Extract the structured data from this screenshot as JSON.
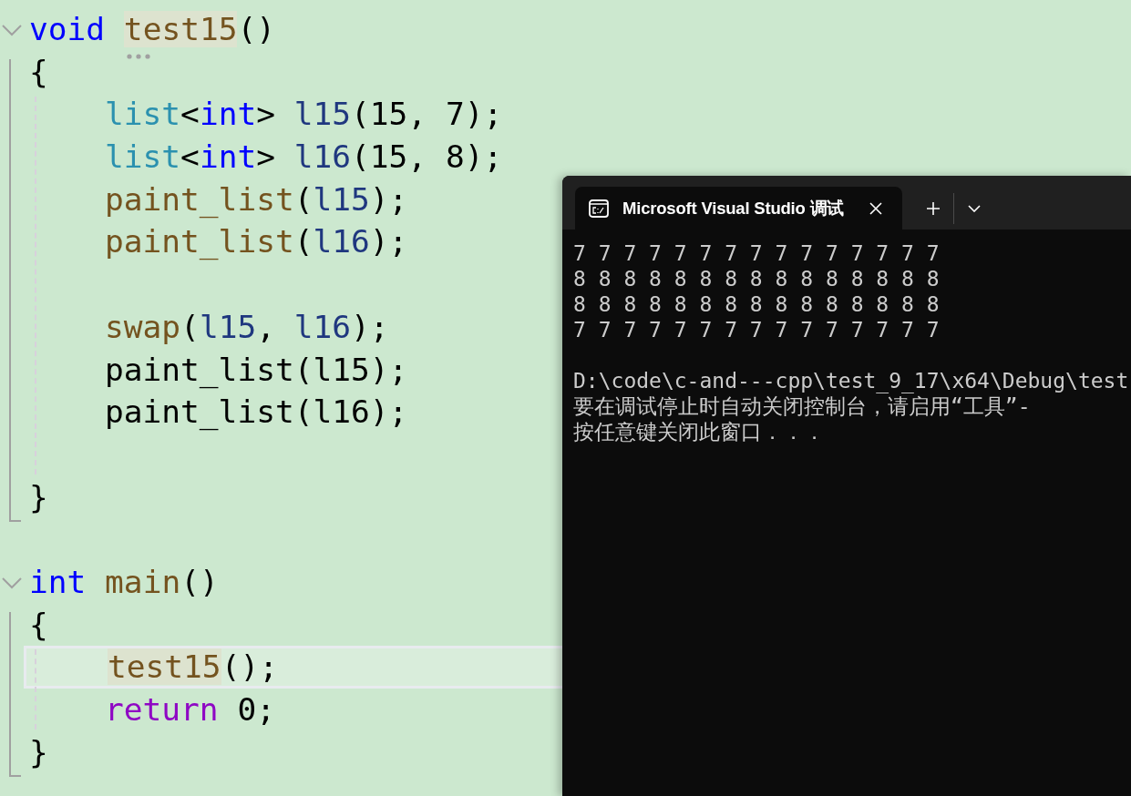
{
  "editor": {
    "blocks": [
      {
        "expanded": true,
        "head": [
          {
            "kind": "code",
            "current": false,
            "tokens": [
              {
                "text": "void ",
                "kind": "keyword"
              },
              {
                "text": "test15",
                "kind": "function",
                "highlight": true,
                "hint": true
              },
              {
                "text": "()",
                "kind": "plain"
              }
            ]
          },
          {
            "kind": "code",
            "current": false,
            "tokens": [
              {
                "text": "{",
                "kind": "plain"
              }
            ]
          }
        ],
        "body": [
          {
            "kind": "code",
            "current": false,
            "tokens": [
              {
                "text": "list",
                "kind": "type"
              },
              {
                "text": "<",
                "kind": "plain"
              },
              {
                "text": "int",
                "kind": "keyword"
              },
              {
                "text": "> ",
                "kind": "plain"
              },
              {
                "text": "l15",
                "kind": "variable"
              },
              {
                "text": "(15, 7);",
                "kind": "plain"
              }
            ]
          },
          {
            "kind": "code",
            "current": false,
            "tokens": [
              {
                "text": "list",
                "kind": "type"
              },
              {
                "text": "<",
                "kind": "plain"
              },
              {
                "text": "int",
                "kind": "keyword"
              },
              {
                "text": "> ",
                "kind": "plain"
              },
              {
                "text": "l16",
                "kind": "variable"
              },
              {
                "text": "(15, 8);",
                "kind": "plain"
              }
            ]
          },
          {
            "kind": "code",
            "current": false,
            "tokens": [
              {
                "text": "paint_list",
                "kind": "function"
              },
              {
                "text": "(",
                "kind": "plain"
              },
              {
                "text": "l15",
                "kind": "variable"
              },
              {
                "text": ");",
                "kind": "plain"
              }
            ]
          },
          {
            "kind": "code",
            "current": false,
            "tokens": [
              {
                "text": "paint_list",
                "kind": "function"
              },
              {
                "text": "(",
                "kind": "plain"
              },
              {
                "text": "l16",
                "kind": "variable"
              },
              {
                "text": ");",
                "kind": "plain"
              }
            ]
          },
          {
            "kind": "blank"
          },
          {
            "kind": "code",
            "current": false,
            "tokens": [
              {
                "text": "swap",
                "kind": "function"
              },
              {
                "text": "(",
                "kind": "plain"
              },
              {
                "text": "l15",
                "kind": "variable"
              },
              {
                "text": ", ",
                "kind": "plain"
              },
              {
                "text": "l16",
                "kind": "variable"
              },
              {
                "text": ");",
                "kind": "plain"
              }
            ]
          },
          {
            "kind": "code",
            "current": false,
            "tokens": [
              {
                "text": "paint_list(l15);",
                "kind": "plain"
              }
            ]
          },
          {
            "kind": "code",
            "current": false,
            "tokens": [
              {
                "text": "paint_list(l16);",
                "kind": "plain"
              }
            ]
          },
          {
            "kind": "blank"
          }
        ],
        "tail": [
          {
            "kind": "code",
            "current": false,
            "tokens": [
              {
                "text": "}",
                "kind": "plain"
              }
            ]
          }
        ]
      },
      {
        "expanded": true,
        "head": [
          {
            "kind": "code",
            "current": false,
            "tokens": [
              {
                "text": "int ",
                "kind": "keyword"
              },
              {
                "text": "main",
                "kind": "function"
              },
              {
                "text": "()",
                "kind": "plain"
              }
            ]
          },
          {
            "kind": "code",
            "current": false,
            "tokens": [
              {
                "text": "{",
                "kind": "plain"
              }
            ]
          }
        ],
        "body": [
          {
            "kind": "code",
            "current": true,
            "tokens": [
              {
                "text": "test15",
                "kind": "function",
                "highlight": true
              },
              {
                "text": "();",
                "kind": "plain"
              }
            ]
          },
          {
            "kind": "code",
            "current": false,
            "tokens": [
              {
                "text": "return",
                "kind": "control"
              },
              {
                "text": " 0;",
                "kind": "plain"
              }
            ]
          }
        ],
        "tail": [
          {
            "kind": "code",
            "current": false,
            "tokens": [
              {
                "text": "}",
                "kind": "plain"
              }
            ]
          }
        ]
      }
    ]
  },
  "terminal": {
    "tab": {
      "title": "Microsoft Visual Studio 调试",
      "selected": true
    },
    "output_blocks": [
      [
        "7 7 7 7 7 7 7 7 7 7 7 7 7 7 7",
        "8 8 8 8 8 8 8 8 8 8 8 8 8 8 8",
        "8 8 8 8 8 8 8 8 8 8 8 8 8 8 8",
        "7 7 7 7 7 7 7 7 7 7 7 7 7 7 7"
      ],
      [
        "D:\\code\\c-and---cpp\\test_9_17\\x64\\Debug\\test",
        "要在调试停止时自动关闭控制台，请启用“工具”-",
        "按任意键关闭此窗口．．．"
      ]
    ]
  }
}
